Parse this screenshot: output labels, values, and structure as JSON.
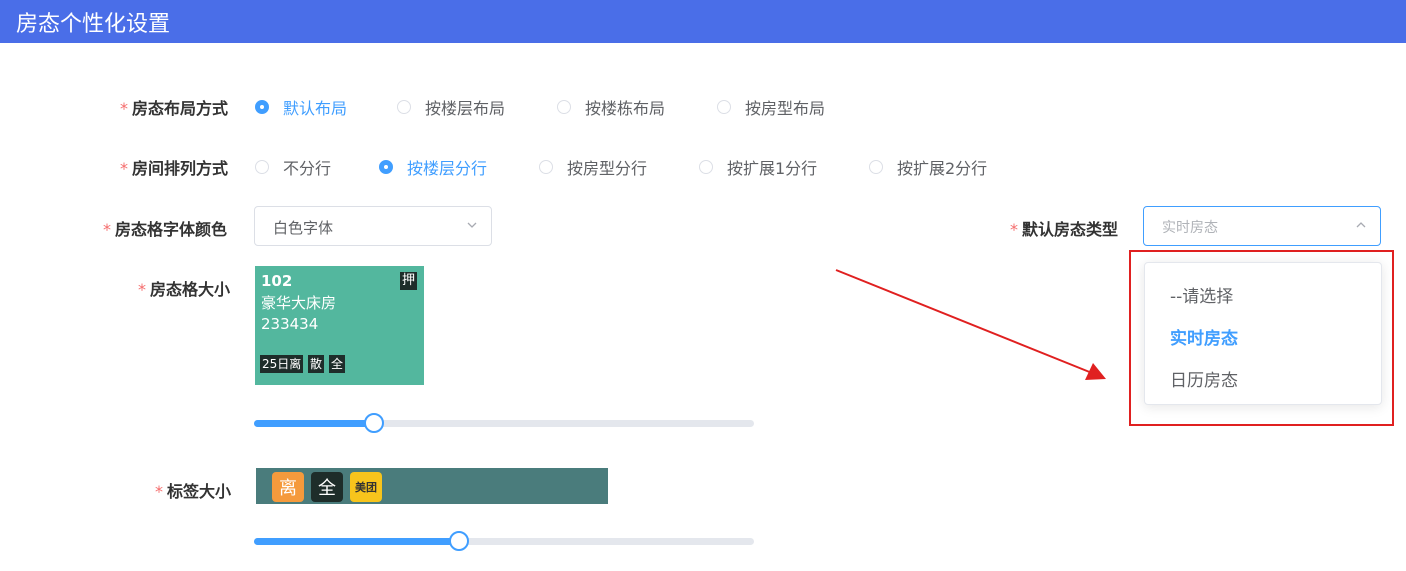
{
  "header": {
    "title": "房态个性化设置"
  },
  "form": {
    "layout": {
      "label": "房态布局方式",
      "options": [
        "默认布局",
        "按楼层布局",
        "按楼栋布局",
        "按房型布局"
      ],
      "selected_index": 0
    },
    "arrangement": {
      "label": "房间排列方式",
      "options": [
        "不分行",
        "按楼层分行",
        "按房型分行",
        "按扩展1分行",
        "按扩展2分行"
      ],
      "selected_index": 1
    },
    "font_color": {
      "label": "房态格字体颜色",
      "value": "白色字体"
    },
    "default_type": {
      "label": "默认房态类型",
      "placeholder": "实时房态",
      "options": [
        "--请选择",
        "实时房态",
        "日历房态"
      ],
      "selected_index": 1
    },
    "tile_size": {
      "label": "房态格大小",
      "slider_percent": 24,
      "preview": {
        "room_number": "102",
        "room_type": "豪华大床房",
        "code": "233434",
        "badge": "押",
        "tags": [
          "25日离",
          "散",
          "全"
        ]
      }
    },
    "tag_size": {
      "label": "标签大小",
      "slider_percent": 41,
      "tags": [
        "离",
        "全",
        "美团"
      ]
    }
  },
  "colors": {
    "header_bg": "#4a6ee8",
    "accent": "#409eff",
    "tile_bg": "#53b79e",
    "tag_orange": "#f59a3c",
    "tag_dark": "#1e2d2a",
    "tag_yellow": "#f7c41c",
    "annotation_red": "#e02020"
  }
}
